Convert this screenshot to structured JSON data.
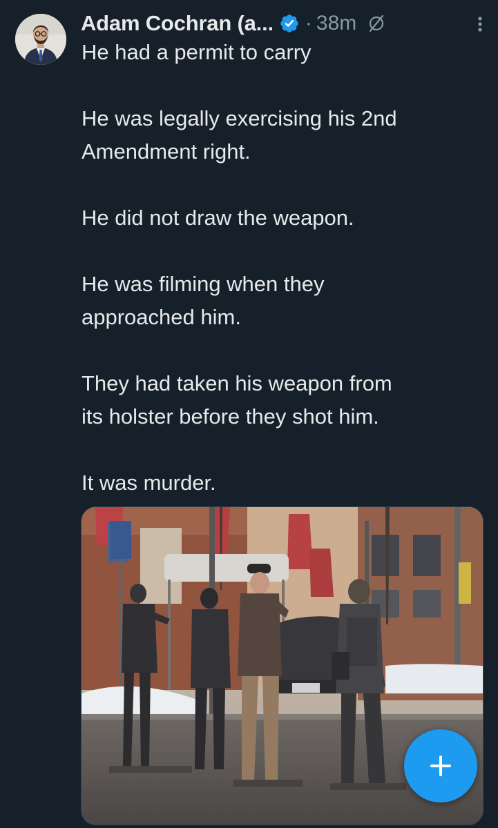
{
  "author": {
    "display_name": "Adam Cochran (a...",
    "verified": true,
    "separator": "·",
    "time": "38m"
  },
  "tweet": {
    "paragraphs": [
      [
        "He had a permit to carry"
      ],
      [
        "He was legally exercising his 2nd",
        "Amendment right."
      ],
      [
        "He did not draw the weapon."
      ],
      [
        "He was filming when they",
        "approached him."
      ],
      [
        "They had taken his weapon from",
        "its holster before they shot him."
      ],
      [
        "It was murder."
      ]
    ]
  },
  "icons": {
    "verified": "verified-badge-icon",
    "edited": "edited-icon",
    "more": "more-options-icon",
    "compose": "plus-icon"
  },
  "colors": {
    "background": "#15202b",
    "text": "#e7e9ea",
    "muted": "#8b98a5",
    "accent": "#1d9bf0"
  }
}
